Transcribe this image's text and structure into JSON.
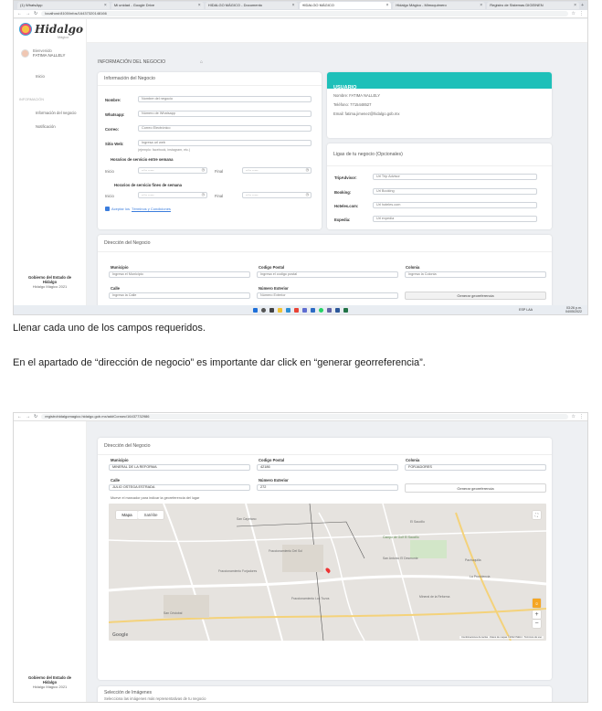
{
  "screenshot1": {
    "tabs": [
      {
        "label": "(1) WhatsApp"
      },
      {
        "label": "Mi unidad - Google Drive"
      },
      {
        "label": "HIDALGO MÁGICO - Documento"
      },
      {
        "label": "HIDALGO MÁGICO"
      },
      {
        "label": "Hidalgo Mágico - Mimoquimero"
      },
      {
        "label": "Registro de Sistemas DIGEINEN"
      }
    ],
    "url": "localhost:8100/infos/16437320148166",
    "logo": "Hidalgo",
    "logo_sub": "Mágico",
    "welcome": "Bienvenido",
    "user_name": "FATIMA NALLELY",
    "nav": {
      "inicio": "Inicio",
      "section": "INFORMACIÓN",
      "info_negocio": "Información del negocio",
      "notificacion": "Notificación"
    },
    "footer": {
      "line1": "Gobierno del Estado de",
      "line2": "Hidalgo",
      "line3": "Hidalgo Mágico 2021"
    },
    "page_title": "INFORMACIÓN DEL NEGOCIO",
    "form_card": {
      "title": "Información del Negocio",
      "nombre_label": "Nombre:",
      "nombre_ph": "Nombre del negocio",
      "whatsapp_label": "Whatsapp:",
      "whatsapp_ph": "Número de Whatsapp",
      "correo_label": "Correo:",
      "correo_ph": "Correo Electrónico",
      "sitio_label": "Sitio Web:",
      "sitio_ph": "Ingresa url web",
      "sitio_hint": "(ejemplo: facebook, instagram, etc.)",
      "horario_semana": "Horarios de servicio entre semana",
      "horario_fin": "Horarios de servicio fines de semana",
      "inicio_label": "Inicio",
      "final_label": "Final",
      "time_ph": "--:-- -----",
      "terminos_prefix": "Aceptar los",
      "terminos_link": "Términos y Condiciones"
    },
    "user_card": {
      "title": "USUARIO",
      "nombre": "Nombre: FATIMA NALLELY",
      "telefono": "Teléfono: 7715448527",
      "email": "Email: fatima.jimenez@hidalgo.gob.mx"
    },
    "links_card": {
      "title": "Ligas de tu negocio (Opcionales)",
      "trip_label": "TripAdvisor:",
      "trip_ph": "Url Trip Advisor",
      "booking_label": "Booking:",
      "booking_ph": "Url Booking",
      "hoteles_label": "Hoteles.com:",
      "hoteles_ph": "Url hoteles.com",
      "expedia_label": "Expedia:",
      "expedia_ph": "Url expedia"
    },
    "address_card": {
      "title": "Dirección del Negocio",
      "municipio_label": "Municipio",
      "municipio_ph": "Ingresa el Municipio",
      "cp_label": "Codigo Postal",
      "cp_ph": "Ingresa el codigo postal",
      "colonia_label": "Colonia",
      "colonia_ph": "Ingresa la Colonia",
      "calle_label": "Calle",
      "calle_ph": "Ingresa la Calle",
      "num_label": "Número Exterior",
      "num_ph": "Número Exterior",
      "geo_button": "Generar georeferencia"
    },
    "clock": {
      "time": "03:26 p.m.",
      "date": "04/05/2022",
      "lang": "ESP LAA"
    }
  },
  "caption1": "Llenar cada uno de los campos requeridos.",
  "caption2": "En el apartado de “dirección de negocio” es importante dar click en “generar georreferencia”.",
  "screenshot2": {
    "url": "registrohidalgomagico.hidalgo.gob.mx/addConsec/16437732986",
    "address_card": {
      "title": "Dirección del Negocio",
      "municipio_label": "Municipio",
      "municipio_val": "MINERAL DE LA REFORMA",
      "cp_label": "Codigo Postal",
      "cp_val": "42186",
      "colonia_label": "Colonia",
      "colonia_val": "FORJADORES",
      "calle_label": "Calle",
      "calle_val": "JULIO OSTEGA ESTRADA",
      "num_label": "Número Exterior",
      "num_val": "272",
      "geo_button": "Generar georeferencia",
      "hint": "Mueve el marcador para indicar la georeferencia del lugar"
    },
    "map": {
      "mapa": "Mapa",
      "satelite": "Satélite",
      "google": "Google",
      "footer": "Combinaciones de teclas · Datos de mapas ©2022 INEGI · Términos de uso",
      "places": [
        "San Cayetano",
        "El Saucillo",
        "Campo de Golf El Saucillo",
        "Fraccionamiento Del Sol",
        "San Antonio El Desmonte",
        "Pachuquilla",
        "Fraccionamiento Forjadores",
        "Fraccionamiento Los Tuzos",
        "La Providencia",
        "Mineral de la Reforma",
        "San Cristobal"
      ]
    },
    "footer": {
      "line1": "Gobierno del Estado de",
      "line2": "Hidalgo",
      "line3": "Hidalgo Mágico 2021"
    },
    "images_card": {
      "title": "Selección de Imágenes",
      "subtitle": "Selecciona las imágenes más representativas de tu negocio"
    }
  }
}
